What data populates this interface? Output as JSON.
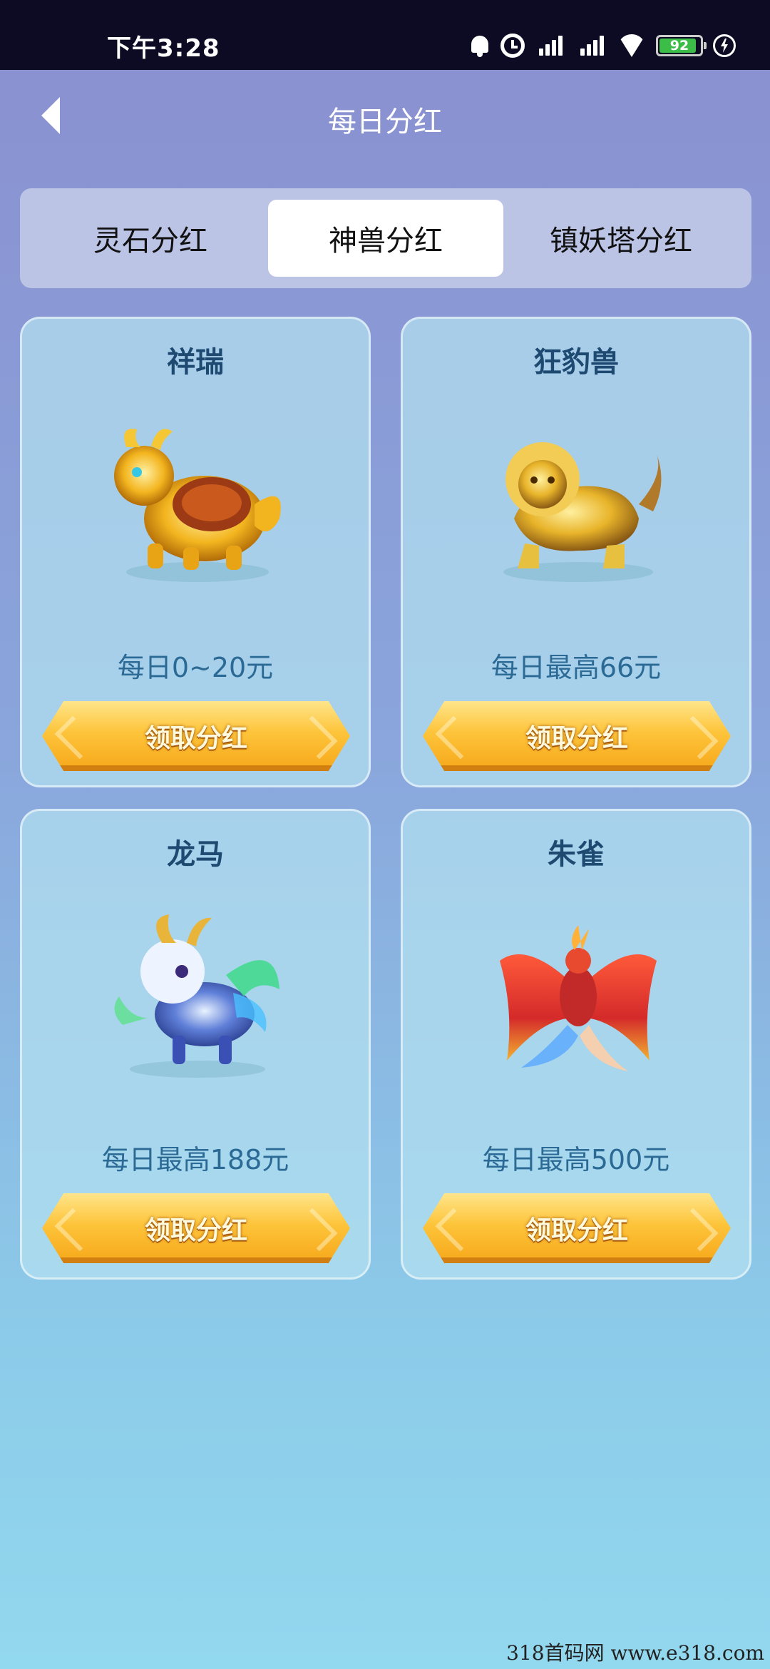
{
  "status_bar": {
    "time": "下午3:28",
    "battery_level": "92",
    "battery_fraction": 0.92,
    "icons": [
      "bell-icon",
      "alarm-icon",
      "signal-icon",
      "signal-icon",
      "wifi-icon",
      "battery-icon",
      "charging-icon"
    ]
  },
  "header": {
    "back_icon": "chevron-left-icon",
    "title": "每日分红"
  },
  "tabs": [
    {
      "label": "灵石分红",
      "active": false
    },
    {
      "label": "神兽分红",
      "active": true
    },
    {
      "label": "镇妖塔分红",
      "active": false
    }
  ],
  "cards": [
    {
      "name": "祥瑞",
      "amount": "每日0~20元",
      "button": "领取分红",
      "art": "golden-qilin-image"
    },
    {
      "name": "狂豹兽",
      "amount": "每日最高66元",
      "button": "领取分红",
      "art": "golden-leopard-image"
    },
    {
      "name": "龙马",
      "amount": "每日最高188元",
      "button": "领取分红",
      "art": "dragon-horse-image"
    },
    {
      "name": "朱雀",
      "amount": "每日最高500元",
      "button": "领取分红",
      "art": "vermilion-bird-image"
    }
  ],
  "watermark": "318首码网 www.e318.com",
  "colors": {
    "accent_gold": "#fdc43a",
    "title_blue": "#1e4a72",
    "amount_blue": "#2c6a96"
  }
}
